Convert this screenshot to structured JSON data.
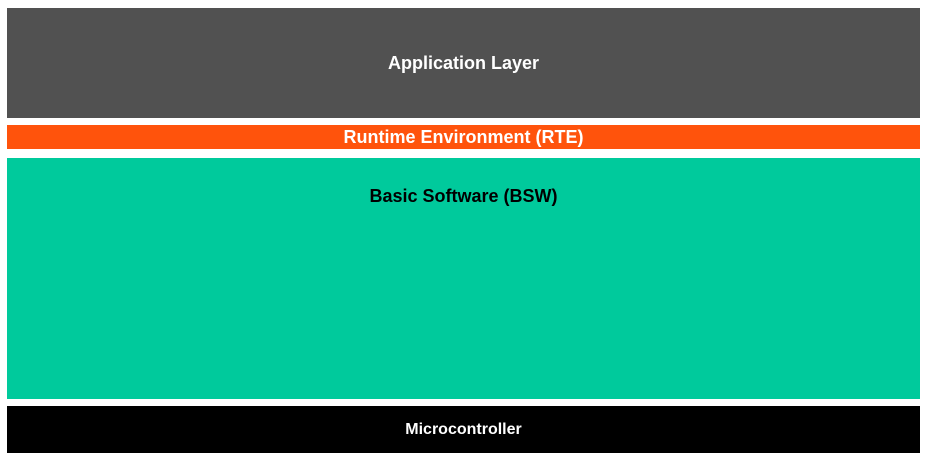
{
  "layers": {
    "application": {
      "label": "Application Layer",
      "bg": "#515151",
      "fg": "#ffffff"
    },
    "rte": {
      "label": "Runtime Environment (RTE)",
      "bg": "#ff530c",
      "fg": "#ffffff"
    },
    "bsw": {
      "label": "Basic Software (BSW)",
      "bg": "#00ca9c",
      "fg": "#000000"
    },
    "microcontroller": {
      "label": "Microcontroller",
      "bg": "#000000",
      "fg": "#ffffff"
    }
  }
}
